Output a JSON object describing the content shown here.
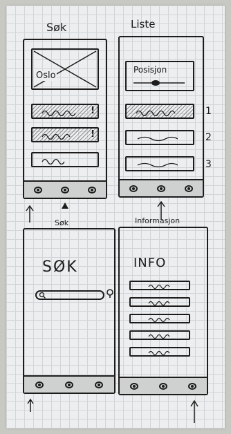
{
  "labels": {
    "sok_top": "Søk",
    "liste_top": "Liste",
    "sok_bottom": "Søk",
    "informasjon_bottom": "Informasjon"
  },
  "sok_screen": {
    "map_label": "Oslo",
    "alert_1": "!",
    "alert_2": "!"
  },
  "liste_screen": {
    "position_label": "Posisjon",
    "row_numbers": [
      "1",
      "2",
      "3"
    ]
  },
  "search_screen": {
    "heading": "SØK"
  },
  "info_screen": {
    "heading": "INFO"
  },
  "icons": [
    "image-placeholder-icon",
    "search-icon",
    "up-arrow-icon",
    "nav-button-icon"
  ]
}
